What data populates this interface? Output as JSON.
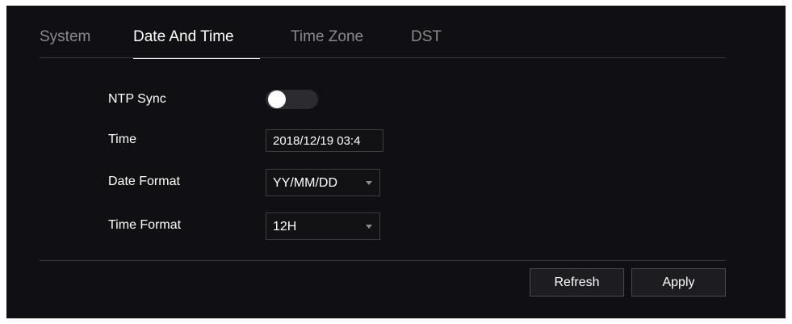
{
  "tabs": [
    {
      "label": "System",
      "active": false
    },
    {
      "label": "Date And Time",
      "active": true
    },
    {
      "label": "Time Zone",
      "active": false
    },
    {
      "label": "DST",
      "active": false
    }
  ],
  "form": {
    "ntp_sync": {
      "label": "NTP Sync",
      "enabled": false
    },
    "time": {
      "label": "Time",
      "value": "2018/12/19 03:4"
    },
    "date_format": {
      "label": "Date Format",
      "value": "YY/MM/DD"
    },
    "time_format": {
      "label": "Time Format",
      "value": "12H"
    }
  },
  "buttons": {
    "refresh": "Refresh",
    "apply": "Apply"
  },
  "colors": {
    "panel_bg": "#101014",
    "active_tab": "#ffffff",
    "inactive_tab": "#8a8a8a"
  }
}
